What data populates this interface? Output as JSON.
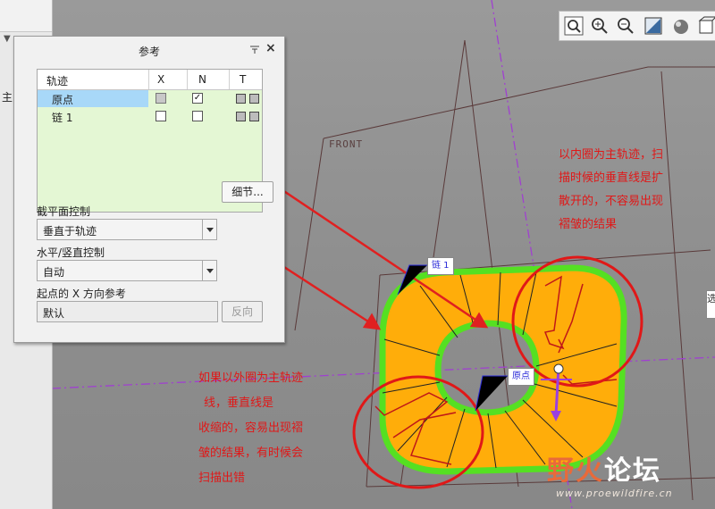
{
  "left_panel": {
    "label": "主",
    "control_text": "▼ ▭"
  },
  "dialog": {
    "title": "参考",
    "pin_icon": "pin-icon",
    "close_label": "×",
    "table": {
      "headers": [
        "轨迹",
        "X",
        "N",
        "T"
      ],
      "rows": [
        {
          "name": "原点",
          "x": "disabled-unchecked",
          "n": "checked",
          "selected": true
        },
        {
          "name": "链 1",
          "x": "unchecked",
          "n": "unchecked",
          "selected": false
        }
      ]
    },
    "details_button": "细节...",
    "section_control_label": "截平面控制",
    "section_control_value": "垂直于轨迹",
    "hv_control_label": "水平/竖直控制",
    "hv_control_value": "自动",
    "x_ref_label": "起点的 X 方向参考",
    "x_ref_value": "默认",
    "reverse_button": "反向"
  },
  "toolbar": {
    "icons": [
      "zoom-fit-icon",
      "zoom-in-icon",
      "zoom-out-icon",
      "repaint-icon",
      "display-style-icon",
      "view-icon"
    ]
  },
  "viewport": {
    "datum_label": "FRONT",
    "tag_chain": "链 1",
    "tag_origin": "原点",
    "note_right": [
      "以内圈为主轨迹，扫",
      "描时候的垂直线是扩",
      "散开的，不容易出现",
      "褶皱的结果"
    ],
    "note_left": [
      "如果以外圈为主轨迹",
      "线，垂直线是",
      "收缩的，容易出现褶",
      "皱的结果，有时候会",
      "扫描出错"
    ],
    "right_edge_char": "选",
    "colors": {
      "fill": "#ffad0a",
      "outline": "#55e022",
      "annotation": "#e02020",
      "datum": "#a050c8"
    }
  },
  "watermark": {
    "title_a": "野火",
    "title_b": "论坛",
    "url": "www.proewildfire.cn"
  }
}
